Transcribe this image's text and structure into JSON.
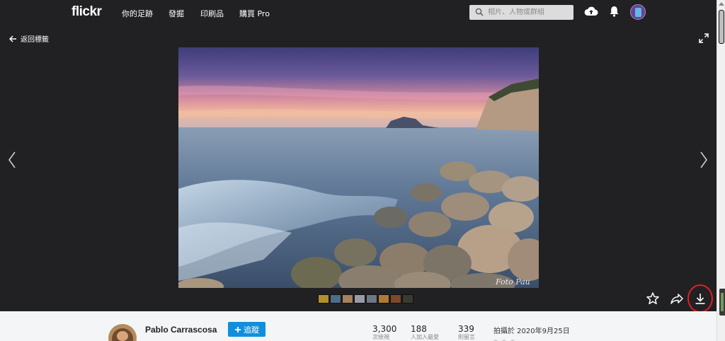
{
  "nav": {
    "logo": "flickr",
    "links": [
      "你的足跡",
      "發掘",
      "印刷品",
      "購買 Pro"
    ],
    "search_placeholder": "相片、人物或群組"
  },
  "stage": {
    "back_label": "返回標籤",
    "watermark": "Foto Pau"
  },
  "owner": {
    "name": "Pablo Carrascosa",
    "follow_label": "追蹤"
  },
  "stats": [
    {
      "value": "3,300",
      "label": "次檢視"
    },
    {
      "value": "188",
      "label": "人加入最愛"
    },
    {
      "value": "339",
      "label": "則留言"
    }
  ],
  "taken": "拍攝於 2020年9月25日",
  "icons": {
    "search": "search-icon",
    "upload": "cloud-upload-icon",
    "bell": "bell-icon",
    "expand": "expand-icon",
    "favorite": "star-icon",
    "share": "share-icon",
    "download": "download-icon"
  },
  "colors": {
    "topbar": "#212124",
    "follow_button": "#128fdc",
    "highlight_ring": "#e02020"
  },
  "thumb_colors": [
    "#b0912a",
    "#4d6d8a",
    "#a6815a",
    "#9a9aa6",
    "#6e7684",
    "#b07a36",
    "#7a4a2a",
    "#3a3a2e"
  ]
}
